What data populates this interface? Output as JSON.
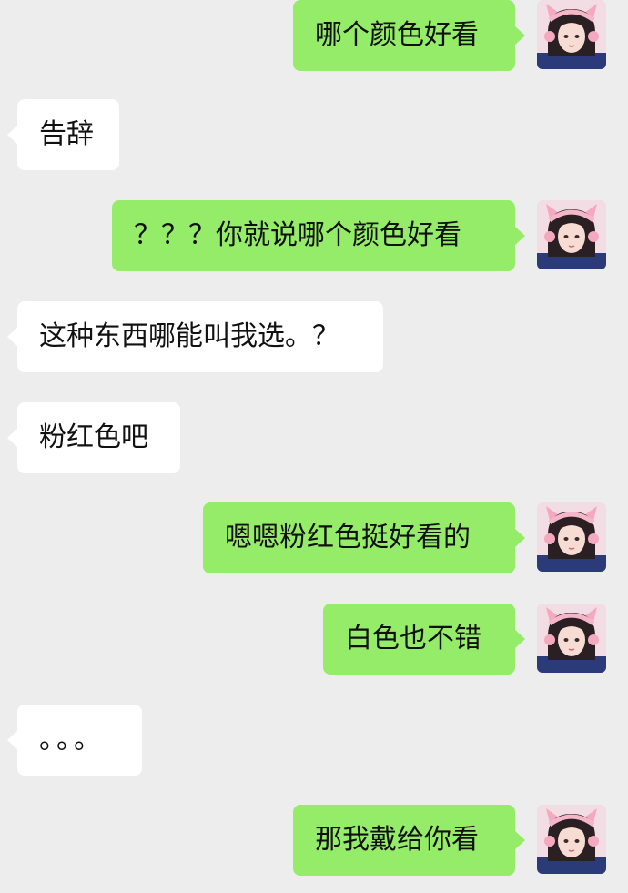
{
  "chat": {
    "messages": [
      {
        "sender": "me",
        "text": "哪个颜色好看"
      },
      {
        "sender": "other",
        "text": "告辞"
      },
      {
        "sender": "me",
        "text": "？？？你就说哪个颜色好看"
      },
      {
        "sender": "other",
        "text": "这种东西哪能叫我选。？"
      },
      {
        "sender": "other",
        "text": "粉红色吧"
      },
      {
        "sender": "me",
        "text": "嗯嗯粉红色挺好看的"
      },
      {
        "sender": "me",
        "text": "白色也不错"
      },
      {
        "sender": "other",
        "text": "。。。"
      },
      {
        "sender": "me",
        "text": "那我戴给你看"
      }
    ]
  },
  "colors": {
    "background": "#ededed",
    "my_bubble": "#95ec69",
    "other_bubble": "#ffffff"
  },
  "icons": {
    "avatar": "avatar-girl-pink-cat-ear-headphones"
  }
}
